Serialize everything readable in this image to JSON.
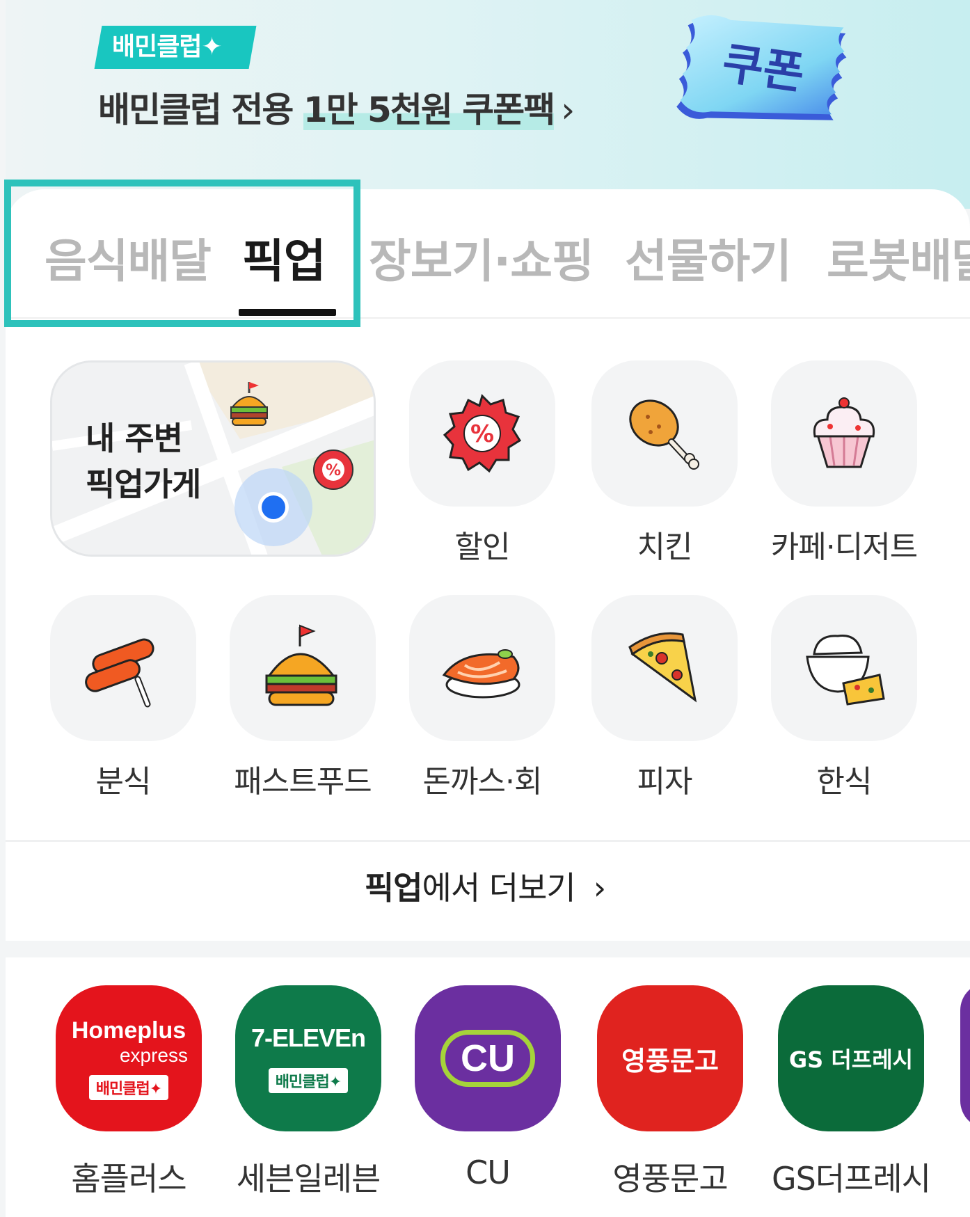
{
  "banner": {
    "badge": "배민클럽✦",
    "text_prefix": "배민클럽 전용 ",
    "text_highlight": "1만 5천원 쿠폰팩",
    "chevron": "›",
    "coupon_label": "쿠폰",
    "colors": {
      "badge": "#19c6c0",
      "coupon": "#3a5bd9"
    }
  },
  "tabs": [
    {
      "label": "음식배달",
      "active": false
    },
    {
      "label": "픽업",
      "active": true
    },
    {
      "label": "장보기·쇼핑",
      "active": false
    },
    {
      "label": "선물하기",
      "active": false
    },
    {
      "label": "로봇배달",
      "active": false
    }
  ],
  "map_card": {
    "line1": "내 주변",
    "line2": "픽업가게"
  },
  "categories": [
    {
      "label": "할인",
      "icon": "discount-badge-icon"
    },
    {
      "label": "치킨",
      "icon": "chicken-leg-icon"
    },
    {
      "label": "카페·디저트",
      "icon": "cupcake-icon"
    },
    {
      "label": "분식",
      "icon": "tteokbokki-icon"
    },
    {
      "label": "패스트푸드",
      "icon": "burger-icon"
    },
    {
      "label": "돈까스·회",
      "icon": "sushi-icon"
    },
    {
      "label": "피자",
      "icon": "pizza-slice-icon"
    },
    {
      "label": "한식",
      "icon": "rice-bowl-icon"
    }
  ],
  "more": {
    "bold": "픽업",
    "rest": "에서 더보기",
    "chevron": "›"
  },
  "brands": [
    {
      "name": "홈플러스",
      "logo_line1": "Homeplus",
      "logo_line2": "express",
      "badge": "배민클럽✦",
      "color": "#e4141c"
    },
    {
      "name": "세븐일레븐",
      "logo_line1": "7-ELEVEn",
      "badge": "배민클럽✦",
      "color": "#0e7a4a"
    },
    {
      "name": "CU",
      "logo_line1": "CU",
      "color": "#6b2fa0"
    },
    {
      "name": "영풍문고",
      "logo_line1": "영풍문고",
      "color": "#e0231f"
    },
    {
      "name": "GS더프레시",
      "logo_line1": "GS 더프레시",
      "color": "#0b6b3a"
    }
  ]
}
